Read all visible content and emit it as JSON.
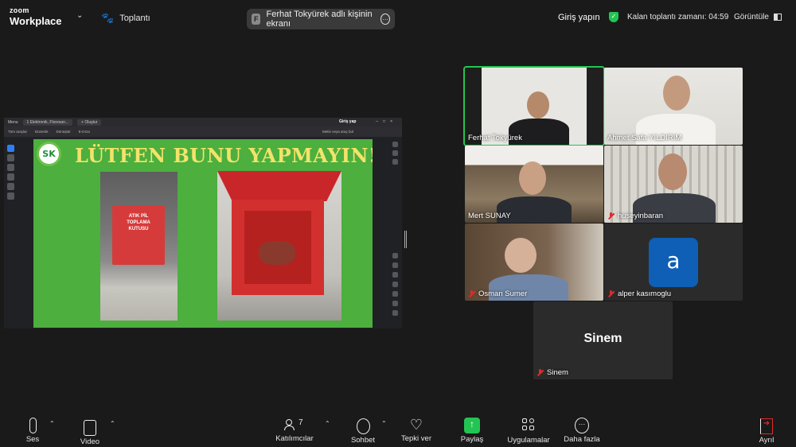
{
  "topbar": {
    "logo_line1": "zoom",
    "logo_line2": "Workplace",
    "meeting_label": "Toplantı",
    "share_initial": "F",
    "share_banner": "Ferhat Tokyürek adlı kişinin ekranı",
    "signin": "Giriş yapın",
    "remaining": "Kalan toplantı zamanı: 04:59",
    "view": "Görüntüle"
  },
  "shared_screen": {
    "browser_menu": "Menu",
    "browser_tab": "1 Elektronik, Floresan...",
    "browser_new_tab": "+ Oluştur",
    "browser_signin": "Giriş yap",
    "toolbar_items": [
      "Tüm araçlar",
      "Düzenle",
      "Dönüştür",
      "E-imza"
    ],
    "find_text": "Metin veya araç bul",
    "slide_logo": "SK",
    "slide_title": "LÜTFEN BUNU YAPMAYIN!",
    "box_label": "ATIK PİL TOPLAMA KUTUSU"
  },
  "participants": [
    {
      "name": "Ferhat Tokyürek",
      "muted": false,
      "active_speaker": true
    },
    {
      "name": "Ahmet Safa YILDIRIM",
      "muted": false,
      "active_speaker": false
    },
    {
      "name": "Mert SUNAY",
      "muted": false,
      "active_speaker": false
    },
    {
      "name": "huseyinbaran",
      "muted": true,
      "active_speaker": false
    },
    {
      "name": "Osman Sumer",
      "muted": true,
      "active_speaker": false
    },
    {
      "name": "alper kasımoglu",
      "muted": true,
      "avatar_letter": "a",
      "avatar_color": "#0e5fb5"
    },
    {
      "name": "Sinem",
      "muted": true,
      "big_label": "Sinem"
    }
  ],
  "toolbar": {
    "audio": "Ses",
    "video": "Video",
    "participants": "Katılımcılar",
    "participant_count": "7",
    "chat": "Sohbet",
    "react": "Tepki ver",
    "share": "Paylaş",
    "apps": "Uygulamalar",
    "more": "Daha fazla",
    "leave": "Ayrıl"
  },
  "colors": {
    "accent_green": "#23c552",
    "muted_red": "#e02a2a",
    "slide_green": "#4caf3e",
    "slide_title_yellow": "#f3e36a"
  },
  "icons": [
    "chevron-down-icon",
    "meeting-paw-icon",
    "more-icon",
    "shield-check-icon",
    "gallery-view-icon",
    "mic-icon",
    "video-icon",
    "participants-icon",
    "chat-icon",
    "heart-icon",
    "share-screen-icon",
    "apps-icon",
    "more-dots-icon",
    "leave-icon",
    "mic-muted-icon"
  ]
}
